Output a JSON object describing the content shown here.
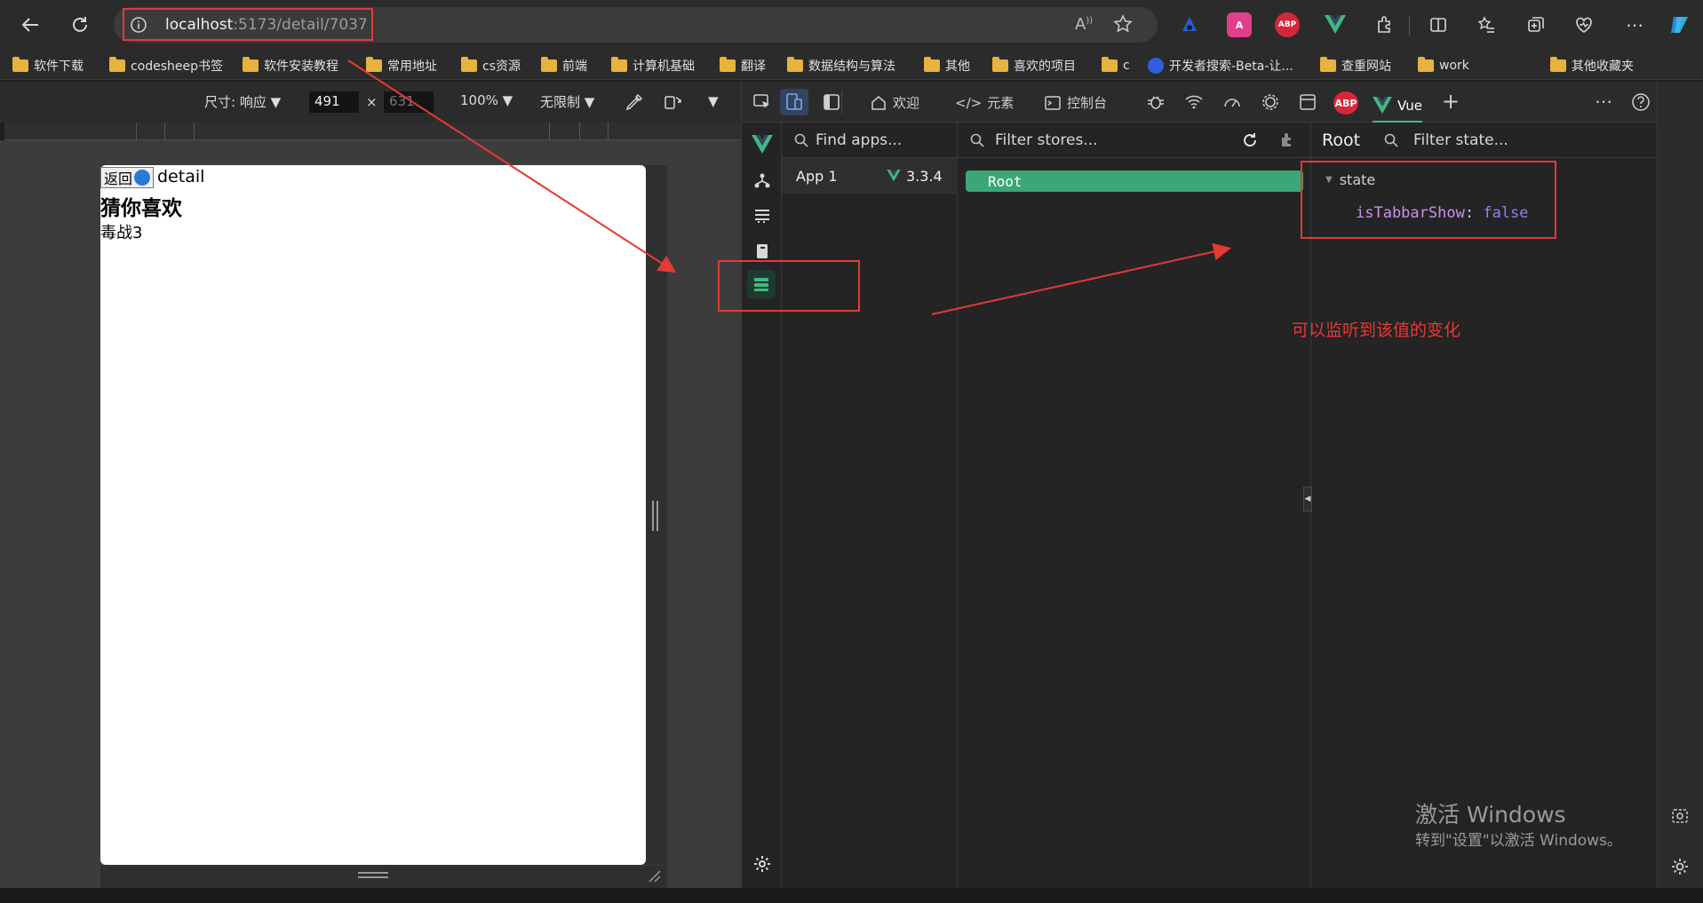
{
  "browser": {
    "address_host": "localhost",
    "address_path": ":5173/detail/7037",
    "ext_translate_label": "A",
    "ext_abp_label": "ABP"
  },
  "bookmarks": [
    "软件下载",
    "codesheep书签",
    "软件安装教程",
    "常用地址",
    "cs资源",
    "前端",
    "计算机基础",
    "翻译",
    "数据结构与算法",
    "其他",
    "喜欢的项目",
    "c",
    "开发者搜索-Beta-让...",
    "查重网站",
    "work",
    "其他收藏夹"
  ],
  "device_toolbar": {
    "size_label": "尺寸: 响应",
    "width": "491",
    "x": "×",
    "height": "631",
    "zoom": "100%",
    "throttle": "无限制"
  },
  "page": {
    "back_label": "返回",
    "detail_label": "detail",
    "heading": "猜你喜欢",
    "item": "毒战3"
  },
  "devtools": {
    "tabs": {
      "welcome": "欢迎",
      "elements": "元素",
      "console": "控制台",
      "vue": "Vue"
    },
    "apps_search": "Find apps...",
    "app_name": "App 1",
    "vue_version": "3.3.4",
    "stores_search": "Filter stores...",
    "store_item": "Root",
    "state_title": "Root",
    "state_search": "Filter state...",
    "state_section": "state",
    "state_key": "isTabbarShow",
    "state_colon": ":",
    "state_value": "false"
  },
  "annotation": {
    "text": "可以监听到该值的变化",
    "color": "#e53935"
  },
  "watermark": {
    "line1": "激活 Windows",
    "line2": "转到\"设置\"以激活 Windows。"
  },
  "colors": {
    "vue_green": "#41b883",
    "root_green": "#3ba776",
    "abp_red": "#d5263a",
    "annotation_red": "#e53935",
    "state_key": "#c792ea",
    "state_value": "#9a7cf0"
  }
}
